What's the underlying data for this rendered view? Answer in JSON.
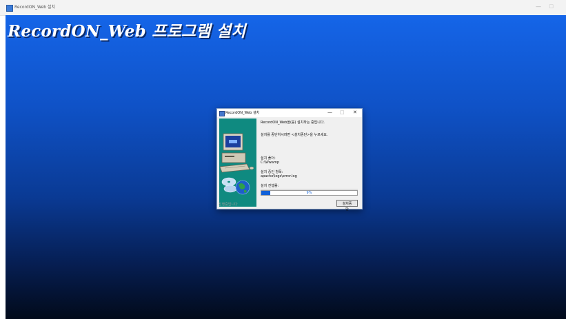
{
  "window": {
    "title": "RecordON_Web 설치",
    "minimize_glyph": "—",
    "restore_glyph": "□"
  },
  "main": {
    "heading": "RecordON_Web 프로그램 설치"
  },
  "dialog": {
    "title": "RecordON_Web 설치",
    "controls": {
      "minimize": "—",
      "maximize": "□",
      "close": "✕"
    },
    "message_installing": "RecordON_Web을(를) 설치하는 중입니다.",
    "message_cancel_hint": "설치를 중단하시려면 <설치중단>을 누르세요.",
    "install_folder_label": "설치 폴더:",
    "install_folder_value": "C:\\Wwamp",
    "installing_item_label": "설치 중인 항목:",
    "installing_item_value": "apache\\logs\\error.log",
    "progress_label": "설치 진행률:",
    "progress_percent": 9,
    "progress_text": "9%",
    "status_footer": "진행중입니다",
    "cancel_button": "설치중단"
  },
  "icons": [
    "app-icon",
    "computer-installer-icon"
  ],
  "colors": {
    "accent": "#1060d8",
    "side_panel": "#0f8a80",
    "backdrop_top": "#1565e8",
    "backdrop_bottom": "#020a1a"
  }
}
